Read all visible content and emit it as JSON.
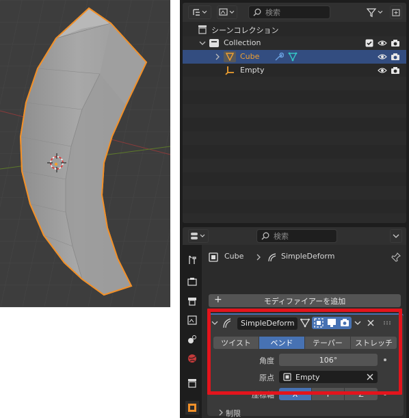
{
  "outliner": {
    "search_placeholder": "検索",
    "scene_collection": "シーンコレクション",
    "rows": [
      {
        "label": "Collection"
      },
      {
        "label": "Cube"
      },
      {
        "label": "Empty"
      }
    ],
    "icons": [
      "outliner-display-mode-icon",
      "filter-icon",
      "new-collection-icon",
      "eye-icon",
      "camera-icon",
      "checkbox-icon",
      "wrench-icon",
      "mesh-data-icon",
      "empty-object-icon",
      "collection-icon"
    ]
  },
  "properties": {
    "search_placeholder": "検索",
    "breadcrumb": {
      "object": "Cube",
      "modifier": "SimpleDeform"
    },
    "add_modifier": "モディファイアーを追加",
    "modifier": {
      "name": "SimpleDeform",
      "modes": [
        "ツイスト",
        "ベンド",
        "テーパー",
        "ストレッチ"
      ],
      "active_mode": "ベンド",
      "angle_label": "角度",
      "angle_value": "106°",
      "origin_label": "原点",
      "origin_value": "Empty",
      "axis_label": "座標軸",
      "axes": [
        "X",
        "Y",
        "Z"
      ],
      "active_axis": "X",
      "restrictions_label": "制限"
    }
  },
  "colors": {
    "selection": "#334d80",
    "active_button": "#4772b3",
    "highlight_box": "#e3141c",
    "object_outline": "#f0902a",
    "cube_label": "#f0a030"
  }
}
